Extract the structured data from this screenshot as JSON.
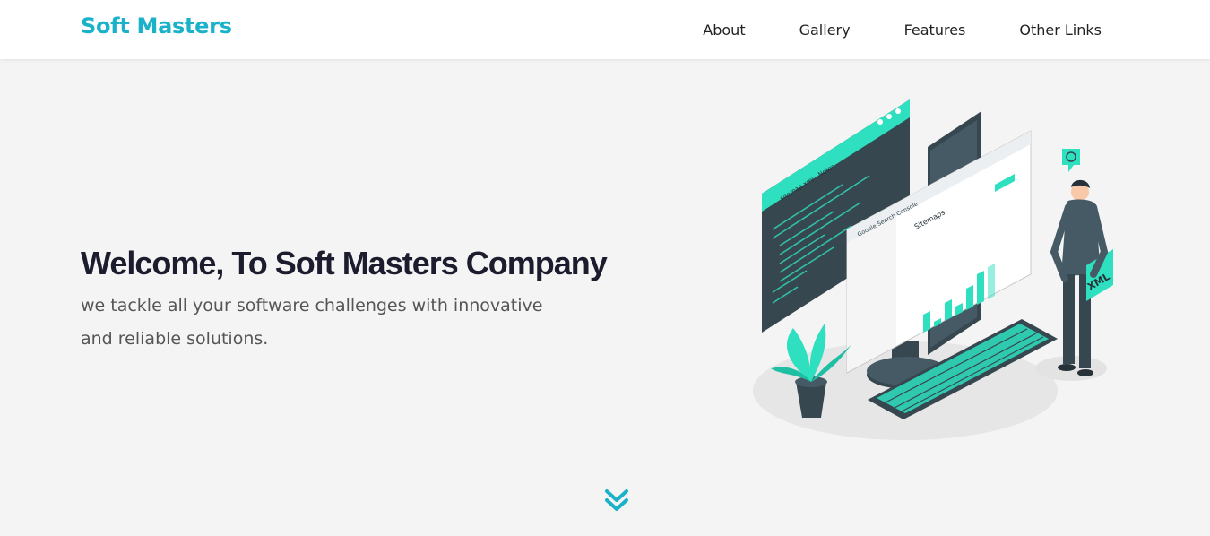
{
  "header": {
    "logo": "Soft Masters",
    "nav": [
      {
        "label": "About"
      },
      {
        "label": "Gallery"
      },
      {
        "label": "Features"
      },
      {
        "label": "Other Links"
      }
    ]
  },
  "hero": {
    "title": "Welcome, To Soft Masters Company",
    "subtitle": "we tackle all your software challenges with innovative and reliable solutions."
  },
  "illustration": {
    "notes_title": "sitemap.xml - Notes",
    "console_title": "Google Search Console",
    "panel_title": "Sitemaps",
    "badge": "XML"
  },
  "colors": {
    "brand": "#1ab2c8",
    "accent": "#2ee0c0",
    "dark": "#263238"
  },
  "icons": {
    "scroll": "chevrons-down-icon"
  }
}
